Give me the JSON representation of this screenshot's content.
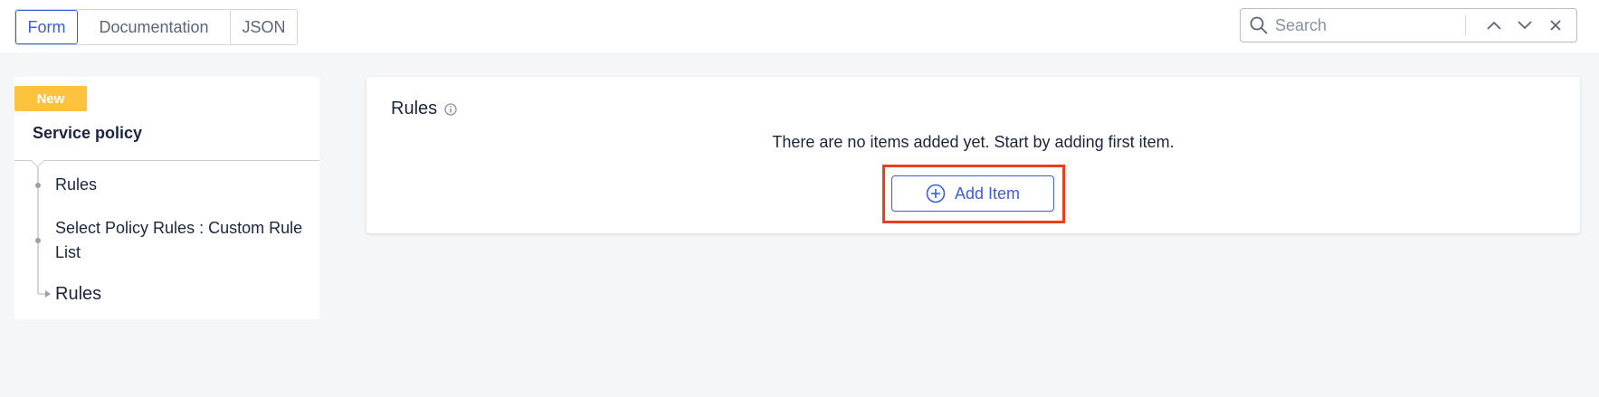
{
  "tabs": [
    {
      "label": "Form",
      "active": true
    },
    {
      "label": "Documentation",
      "active": false
    },
    {
      "label": "JSON",
      "active": false
    }
  ],
  "search": {
    "placeholder": "Search"
  },
  "sidebar": {
    "badge": "New",
    "title": "Service policy",
    "items": [
      {
        "label": "Rules"
      },
      {
        "label": "Select Policy Rules : Custom Rule List"
      },
      {
        "label": "Rules",
        "current": true
      }
    ]
  },
  "main": {
    "title": "Rules",
    "empty_message": "There are no items added yet. Start by adding first item.",
    "add_button_label": "Add Item"
  },
  "colors": {
    "accent": "#3d5dd9",
    "badge": "#fdc23e",
    "highlight": "#e8401c"
  },
  "icons": [
    "search-icon",
    "chevron-up-icon",
    "chevron-down-icon",
    "close-icon",
    "info-icon",
    "plus-circle-icon"
  ]
}
